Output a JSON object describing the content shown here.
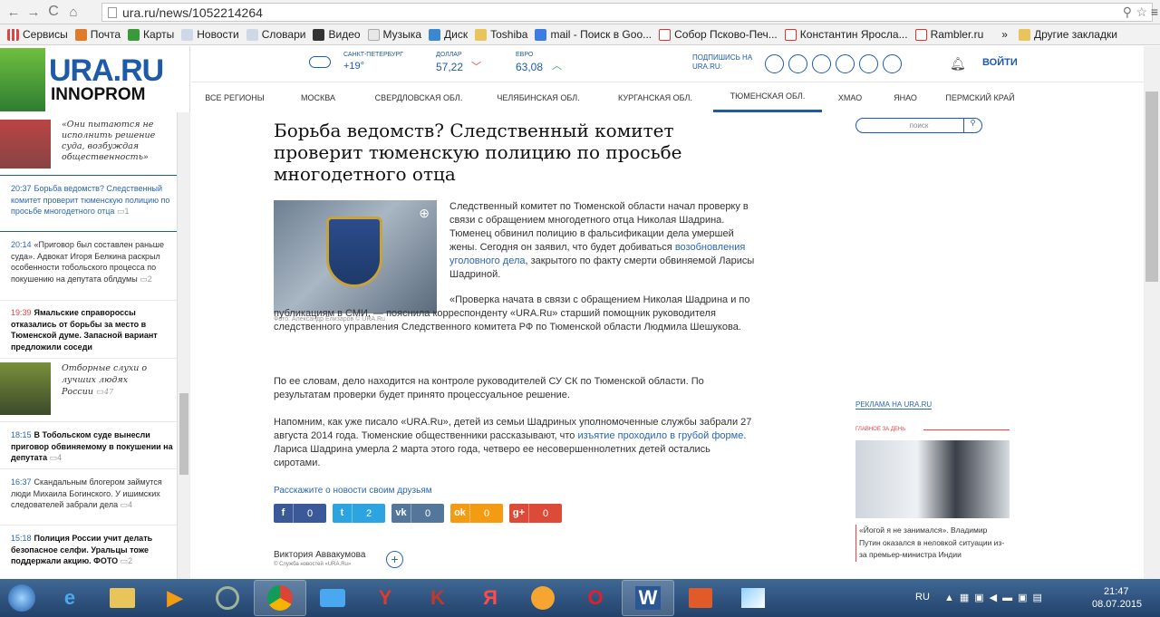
{
  "browser": {
    "url": "ura.ru/news/1052214264",
    "bookmarks": [
      "Сервисы",
      "Почта",
      "Карты",
      "Новости",
      "Словари",
      "Видео",
      "Музыка",
      "Диск",
      "Toshiba",
      "mail - Поиск в Goo...",
      "Собор Псково-Печ...",
      "Константин Яросла...",
      "Rambler.ru",
      "»",
      "Другие закладки"
    ]
  },
  "header": {
    "logo_main": "URA.RU",
    "logo_sub": "INNOPROM",
    "weather_city": "САНКТ-ПЕТЕРБУРГ",
    "weather_temp": "+19°",
    "usd_label": "ДОЛЛАР",
    "usd_value": "57,22",
    "eur_label": "ЕВРО",
    "eur_value": "63,08",
    "subscribe": "ПОДПИШИСЬ НА URA.RU:",
    "login": "ВОЙТИ"
  },
  "regions": [
    "ВСЕ РЕГИОНЫ",
    "МОСКВА",
    "СВЕРДЛОВСКАЯ ОБЛ.",
    "ЧЕЛЯБИНСКАЯ ОБЛ.",
    "КУРГАНСКАЯ ОБЛ.",
    "ТЮМЕНСКАЯ ОБЛ.",
    "ХМАО",
    "ЯНАО",
    "ПЕРМСКИЙ КРАЙ"
  ],
  "feed": {
    "quote1": "«Они пытаются не исполнить решение суда, возбуждая общественность»",
    "items": [
      {
        "time": "20:37",
        "text": "Борьба ведомств? Следственный комитет проверит тюменскую полицию по просьбе многодетного отца",
        "comments": "1",
        "bold": false
      },
      {
        "time": "20:14",
        "text": "«Приговор был составлен раньше суда». Адвокат Игоря Белкина раскрыл особенности тобольского процесса по покушению на депутата облдумы",
        "comments": "2",
        "bold": false
      },
      {
        "time": "19:39",
        "text": "Ямальские справороссы отказались от борьбы за место в Тюменской думе. Запасной вариант предложили соседи",
        "comments": "",
        "bold": true
      }
    ],
    "quote2": "Отборные слухи о лучших людях России",
    "quote2_comments": "47",
    "items2": [
      {
        "time": "18:15",
        "text": "В Тобольском суде вынесли приговор обвиняемому в покушении на депутата",
        "comments": "4",
        "bold": true
      },
      {
        "time": "16:37",
        "text": "Скандальным блогером займутся люди Михаила Богинского. У ишимских следователей забрали дела",
        "comments": "4",
        "bold": false
      },
      {
        "time": "15:18",
        "text": "Полиция России учит делать безопасное селфи. Уральцы тоже поддержали акцию. ФОТО",
        "comments": "2",
        "bold": true
      }
    ]
  },
  "article": {
    "title": "Борьба ведомств? Следственный комитет проверит тюменскую полицию по просьбе многодетного отца",
    "photo_caption": "Фото: Александр Елизаров © URA.Ru",
    "p1a": "Следственный комитет по Тюменской области начал проверку в связи с обращением многодетного отца Николая Шадрина. Тюменец обвинил полицию в фальсификации дела умершей жены. Сегодня он заявил, что будет добиваться ",
    "p1_link": "возобновления уголовного дела",
    "p1b": ", закрытого по факту смерти обвиняемой Ларисы Шадриной.",
    "p2": "«Проверка начата в связи с обращением Николая Шадрина и по публикациям в СМИ, — пояснила корреспонденту «URA.Ru» старший помощник руководителя следственного управления Следственного комитета РФ по Тюменской области Людмила Шешукова.",
    "p3": "По ее словам, дело находится на контроле руководителей СУ СК по Тюменской области. По результатам проверки будет принято процессуальное решение.",
    "p4a": "Напомним, как уже писало «URA.Ru», детей из семьи Шадриных уполномоченные службы забрали 27 августа 2014 года. Тюменские общественники рассказывают, что ",
    "p4_link": "изъятие проходило в грубой форме",
    "p4b": ". Лариса Шадрина умерла 2 марта этого года, четверо ее несовершеннолетних детей остались сиротами.",
    "share_label": "Расскажите о новости своим друзьям",
    "shares": [
      {
        "icon": "f",
        "count": "0",
        "color": "#3b5998"
      },
      {
        "icon": "t",
        "count": "2",
        "color": "#2ba4e0"
      },
      {
        "icon": "vk",
        "count": "0",
        "color": "#54769a"
      },
      {
        "icon": "ok",
        "count": "0",
        "color": "#f39c12"
      },
      {
        "icon": "g+",
        "count": "0",
        "color": "#dc4a38"
      }
    ],
    "author": "Виктория Аввакумова",
    "author_org": "© Служба новостей «URA.Ru»"
  },
  "right": {
    "search_placeholder": "поиск",
    "ad_label": "РЕКЛАМА НА URA.RU",
    "main_day": "ГЛАВНОЕ ЗА ДЕНЬ",
    "main_text": "«Йогой я не занимался». Владимир Путин оказался в неловкой ситуации из-за премьер-министра Индии"
  },
  "taskbar": {
    "lang": "RU",
    "time": "21:47",
    "date": "08.07.2015"
  }
}
